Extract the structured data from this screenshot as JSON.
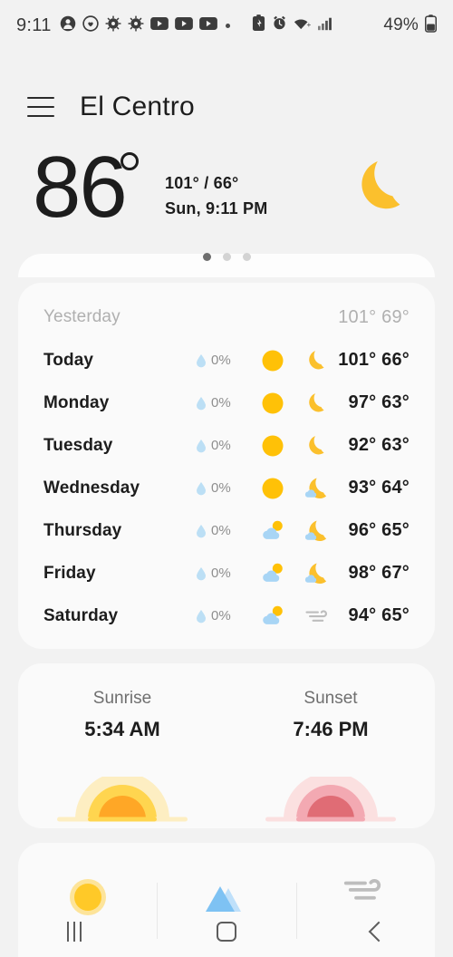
{
  "status_bar": {
    "time": "9:11",
    "battery_text": "49%",
    "icons": [
      "contact-icon",
      "clock-heart-icon",
      "gear-icon",
      "gear-icon",
      "youtube-icon",
      "youtube-icon",
      "youtube-icon",
      "dot-icon",
      "battery-saver-icon",
      "alarm-icon",
      "wifi-icon",
      "signal-icon",
      "battery-icon"
    ]
  },
  "app_bar": {
    "menu_icon": "hamburger-menu-icon",
    "city": "El Centro"
  },
  "current": {
    "temperature": "86",
    "high_low": "101° / 66°",
    "datetime": "Sun, 9:11 PM",
    "condition_icon": "moon-icon",
    "page_dots": 3,
    "active_dot": 0
  },
  "forecast": {
    "rows": [
      {
        "day": "Yesterday",
        "precip": null,
        "day_icon": null,
        "night_icon": null,
        "high": "101°",
        "low": "69°",
        "muted": true
      },
      {
        "day": "Today",
        "precip": "0%",
        "day_icon": "sun-icon",
        "night_icon": "moon-icon",
        "high": "101°",
        "low": "66°",
        "muted": false
      },
      {
        "day": "Monday",
        "precip": "0%",
        "day_icon": "sun-icon",
        "night_icon": "moon-icon",
        "high": "97°",
        "low": "63°",
        "muted": false
      },
      {
        "day": "Tuesday",
        "precip": "0%",
        "day_icon": "sun-icon",
        "night_icon": "moon-icon",
        "high": "92°",
        "low": "63°",
        "muted": false
      },
      {
        "day": "Wednesday",
        "precip": "0%",
        "day_icon": "sun-icon",
        "night_icon": "moon-cloud-icon",
        "high": "93°",
        "low": "64°",
        "muted": false
      },
      {
        "day": "Thursday",
        "precip": "0%",
        "day_icon": "sun-cloud-icon",
        "night_icon": "moon-cloud-icon",
        "high": "96°",
        "low": "65°",
        "muted": false
      },
      {
        "day": "Friday",
        "precip": "0%",
        "day_icon": "sun-cloud-icon",
        "night_icon": "moon-cloud-icon",
        "high": "98°",
        "low": "67°",
        "muted": false
      },
      {
        "day": "Saturday",
        "precip": "0%",
        "day_icon": "sun-cloud-icon",
        "night_icon": "wind-icon",
        "high": "94°",
        "low": "65°",
        "muted": false
      }
    ]
  },
  "sun_card": {
    "sunrise_label": "Sunrise",
    "sunrise_time": "5:34 AM",
    "sunrise_icon": "sunrise-icon",
    "sunset_label": "Sunset",
    "sunset_time": "7:46 PM",
    "sunset_icon": "sunset-icon"
  },
  "detail_card": {
    "items": [
      {
        "icon": "uv-sun-icon"
      },
      {
        "icon": "mountains-aqi-icon"
      },
      {
        "icon": "wind-icon"
      }
    ]
  },
  "nav_bar": {
    "recents_icon": "recents-icon",
    "home_icon": "home-icon",
    "back_icon": "back-icon"
  },
  "colors": {
    "background": "#f2f2f2",
    "card": "#fafafa",
    "sun_yellow": "#ffc107",
    "moon_yellow": "#fbc02d",
    "cloud_blue": "#a8d5f5",
    "drop_blue": "#bcdff5",
    "sunset_red": "#e06c75",
    "text_primary": "#1d1d1d",
    "text_muted": "#b0b0b0"
  }
}
